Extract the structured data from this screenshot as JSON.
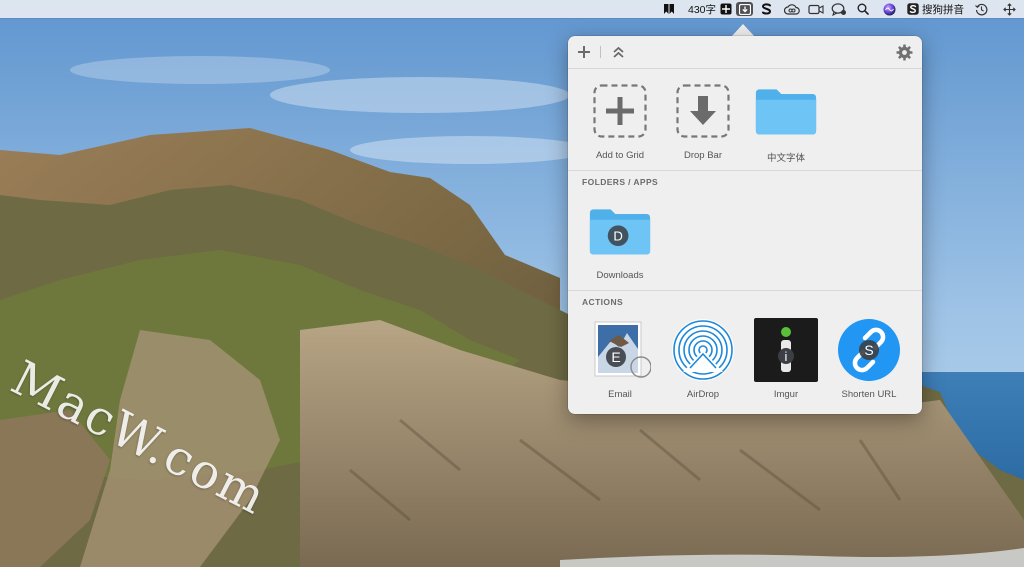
{
  "menubar": {
    "word_count": "430字",
    "input_method": "搜狗拼音"
  },
  "popover": {
    "grid_items": [
      {
        "label": "Add to Grid"
      },
      {
        "label": "Drop Bar"
      },
      {
        "label": "中文字体"
      }
    ],
    "folders_header": "FOLDERS / APPS",
    "folders": [
      {
        "label": "Downloads",
        "glyph": "D"
      }
    ],
    "actions_header": "ACTIONS",
    "actions": [
      {
        "label": "Email",
        "glyph": "E"
      },
      {
        "label": "AirDrop"
      },
      {
        "label": "Imgur",
        "glyph": "i"
      },
      {
        "label": "Shorten URL",
        "glyph": "S"
      }
    ]
  },
  "watermark": "MacW.com",
  "colors": {
    "popover_bg": "#efefef",
    "folder_blue": "#5ab8f0",
    "airdrop_blue": "#1e88d8",
    "shorten_blue": "#2196f3"
  }
}
